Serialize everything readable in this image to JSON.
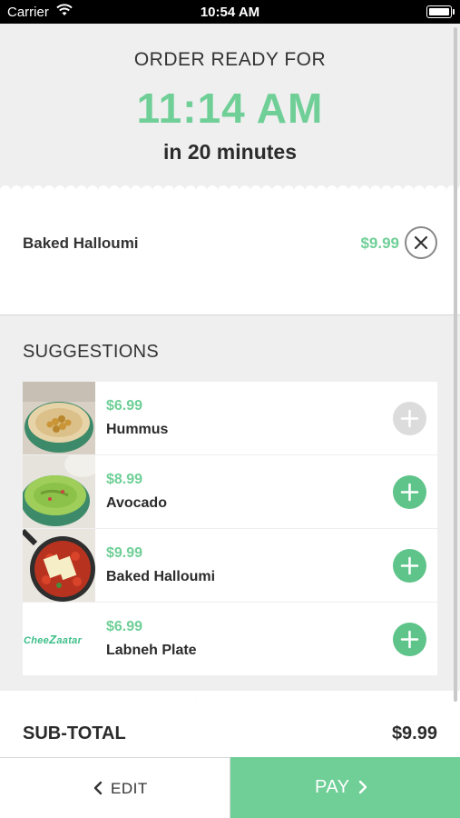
{
  "status_bar": {
    "carrier": "Carrier",
    "time": "10:54 AM"
  },
  "header": {
    "ready_label": "ORDER READY FOR",
    "eta_time": "11:14 AM",
    "eta_relative": "in 20 minutes"
  },
  "order": {
    "items": [
      {
        "name": "Baked Halloumi",
        "price": "$9.99"
      }
    ]
  },
  "suggestions": {
    "title": "SUGGESTIONS",
    "items": [
      {
        "name": "Hummus",
        "price": "$6.99",
        "image": "hummus-bowl",
        "add_enabled": false
      },
      {
        "name": "Avocado",
        "price": "$8.99",
        "image": "avocado-bowl",
        "add_enabled": true
      },
      {
        "name": "Baked Halloumi",
        "price": "$9.99",
        "image": "halloumi-skillet",
        "add_enabled": true
      },
      {
        "name": "Labneh Plate",
        "price": "$6.99",
        "image": "cheezaatar-logo",
        "logo_text": "CheeZaatar",
        "add_enabled": true
      }
    ]
  },
  "totals": {
    "subtotal_label": "SUB-TOTAL",
    "subtotal_value": "$9.99"
  },
  "actions": {
    "edit_label": "EDIT",
    "pay_label": "PAY"
  },
  "colors": {
    "accent": "#6fcf97",
    "add_button": "#5ec489",
    "add_disabled": "#dcdcdc",
    "background": "#efefef"
  }
}
